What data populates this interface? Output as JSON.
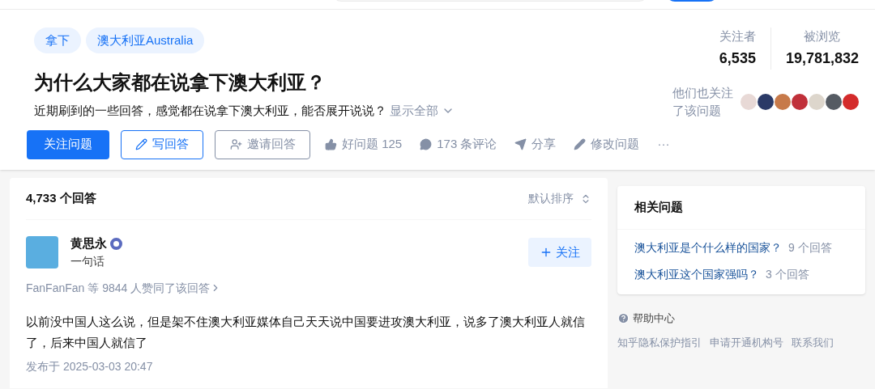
{
  "topics": [
    "拿下",
    "澳大利亚Australia"
  ],
  "question": {
    "title": "为什么大家都在说拿下澳大利亚？",
    "detail": "近期刷到的一些回答，感觉都在说拿下澳大利亚，能否展开说说？",
    "expand": "显示全部"
  },
  "actions": [
    {
      "kind": "primary",
      "label": "关注问题"
    },
    {
      "kind": "outline",
      "label": "写回答"
    },
    {
      "kind": "outline-gray",
      "label": "邀请回答"
    },
    {
      "kind": "plain",
      "label": "好问题 125"
    },
    {
      "kind": "plain",
      "label": "173 条评论"
    },
    {
      "kind": "plain",
      "label": "分享"
    },
    {
      "kind": "plain",
      "label": "修改问题"
    },
    {
      "kind": "plain",
      "label": "···"
    }
  ],
  "stats": [
    {
      "label": "关注者",
      "value": "6,535"
    },
    {
      "label": "被浏览",
      "value": "19,781,832"
    }
  ],
  "followers_label": "他们也关注了该问题",
  "answers": {
    "count": "4,733 个回答",
    "sort": "默认排序",
    "author": {
      "name": "黄思永",
      "bio": "一句话",
      "follow": "关注"
    },
    "votes": "FanFanFan 等 9844 人赞同了该回答",
    "text": "以前没中国人这么说，但是架不住澳大利亚媒体自己天天说中国要进攻澳大利亚，说多了澳大利亚人就信了，后来中国人就信了",
    "time": "发布于 2025-03-03 20:47"
  },
  "related": {
    "title": "相关问题",
    "items": [
      {
        "question": "澳大利亚是个什么样的国家？",
        "count": "9 个回答"
      },
      {
        "question": "澳大利亚这个国家强吗？",
        "count": "3 个回答"
      }
    ]
  },
  "help": {
    "title": "帮助中心",
    "links": [
      "知乎隐私保护指引",
      "申请开通机构号",
      "联系我们"
    ]
  }
}
